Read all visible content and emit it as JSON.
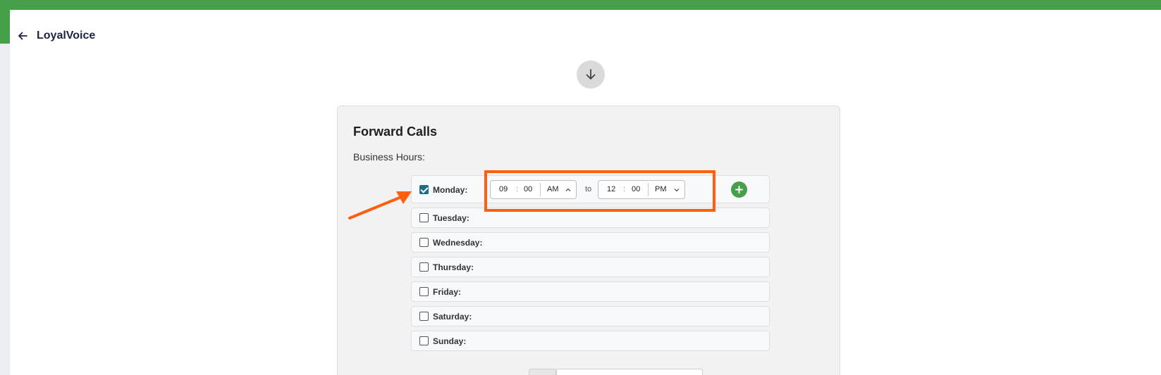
{
  "app": {
    "title": "LoyalVoice"
  },
  "card": {
    "title": "Forward Calls",
    "subtitle": "Business Hours:"
  },
  "days": [
    {
      "label": "Monday:",
      "checked": true
    },
    {
      "label": "Tuesday:",
      "checked": false
    },
    {
      "label": "Wednesday:",
      "checked": false
    },
    {
      "label": "Thursday:",
      "checked": false
    },
    {
      "label": "Friday:",
      "checked": false
    },
    {
      "label": "Saturday:",
      "checked": false
    },
    {
      "label": "Sunday:",
      "checked": false
    }
  ],
  "monday_hours": {
    "from": {
      "hour": "09",
      "minute": "00",
      "ampm": "AM"
    },
    "separator": "to",
    "to": {
      "hour": "12",
      "minute": "00",
      "ampm": "PM"
    }
  },
  "colors": {
    "brand_green": "#45a049",
    "highlight_orange": "#ff5f0f",
    "checkbox_checked": "#1c6e86"
  },
  "icons": {
    "back": "arrow-left-icon",
    "step": "arrow-down-circle-icon",
    "add": "plus-icon",
    "annotation": "annotation-arrow-icon"
  }
}
